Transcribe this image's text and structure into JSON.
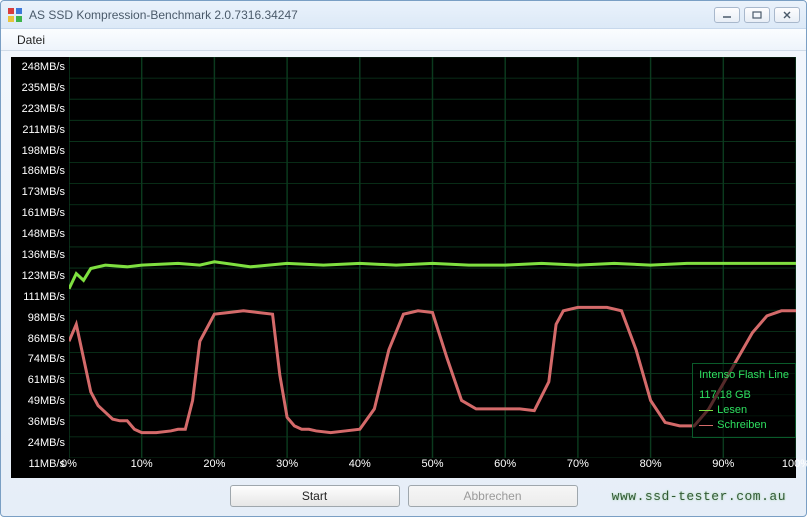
{
  "window": {
    "title": "AS SSD Kompression-Benchmark 2.0.7316.34247"
  },
  "menu": {
    "datei": "Datei"
  },
  "buttons": {
    "start": "Start",
    "abbrechen": "Abbrechen"
  },
  "watermark": "www.ssd-tester.com.au",
  "legend": {
    "device": "Intenso Flash Line",
    "capacity": "117,18 GB",
    "read": "Lesen",
    "write": "Schreiben"
  },
  "colors": {
    "read": "#7fe040",
    "write": "#d46a6a",
    "grid": "#0b3a1e",
    "axis": "#ffffff",
    "legend_border": "#0a5a2a",
    "legend_text": "#2ee060"
  },
  "chart_data": {
    "type": "line",
    "xlabel": "",
    "ylabel": "",
    "xlim": [
      0,
      100
    ],
    "ylim": [
      11,
      248
    ],
    "x_ticks": [
      "0%",
      "10%",
      "20%",
      "30%",
      "40%",
      "50%",
      "60%",
      "70%",
      "80%",
      "90%",
      "100%"
    ],
    "y_ticks": [
      "248MB/s",
      "235MB/s",
      "223MB/s",
      "211MB/s",
      "198MB/s",
      "186MB/s",
      "173MB/s",
      "161MB/s",
      "148MB/s",
      "136MB/s",
      "123MB/s",
      "111MB/s",
      "98MB/s",
      "86MB/s",
      "74MB/s",
      "61MB/s",
      "49MB/s",
      "36MB/s",
      "24MB/s",
      "11MB/s"
    ],
    "series": [
      {
        "name": "Lesen",
        "color": "#7fe040",
        "x": [
          0,
          1,
          2,
          3,
          5,
          8,
          10,
          15,
          18,
          20,
          25,
          30,
          35,
          40,
          45,
          50,
          55,
          60,
          65,
          70,
          75,
          80,
          85,
          90,
          95,
          100
        ],
        "y": [
          111,
          120,
          116,
          123,
          125,
          124,
          125,
          126,
          125,
          127,
          124,
          126,
          125,
          126,
          125,
          126,
          125,
          125,
          126,
          125,
          126,
          125,
          126,
          126,
          126,
          126
        ]
      },
      {
        "name": "Schreiben",
        "color": "#d46a6a",
        "x": [
          0,
          1,
          2,
          3,
          4,
          5,
          6,
          7,
          8,
          9,
          10,
          12,
          14,
          15,
          16,
          17,
          18,
          20,
          22,
          24,
          26,
          28,
          29,
          30,
          31,
          32,
          33,
          34,
          36,
          38,
          40,
          42,
          44,
          46,
          47,
          48,
          50,
          52,
          54,
          56,
          58,
          60,
          62,
          64,
          66,
          67,
          68,
          70,
          72,
          74,
          76,
          78,
          80,
          82,
          84,
          85,
          86,
          88,
          90,
          92,
          94,
          96,
          98,
          100
        ],
        "y": [
          80,
          90,
          70,
          50,
          42,
          38,
          34,
          33,
          33,
          28,
          26,
          26,
          27,
          28,
          28,
          45,
          80,
          96,
          97,
          98,
          97,
          96,
          60,
          35,
          30,
          28,
          28,
          27,
          26,
          27,
          28,
          40,
          75,
          96,
          97,
          98,
          97,
          70,
          45,
          40,
          40,
          40,
          40,
          39,
          56,
          90,
          98,
          100,
          100,
          100,
          98,
          75,
          45,
          32,
          30,
          30,
          30,
          40,
          55,
          70,
          85,
          95,
          98,
          98
        ]
      }
    ]
  }
}
